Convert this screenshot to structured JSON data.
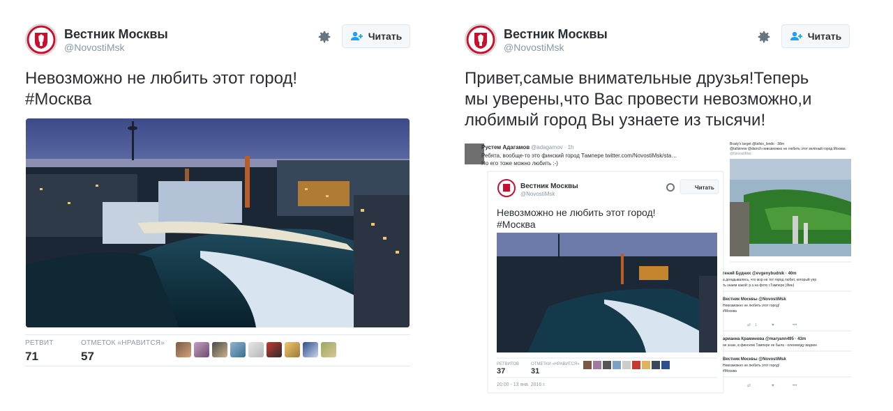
{
  "left_tweet": {
    "author_name": "Вестник Москвы",
    "author_handle": "@NovostiMsk",
    "follow_label": "Читать",
    "text_line1": "Невозможно не любить этот город!",
    "text_line2": "#Москва",
    "retweets_label": "РЕТВИТ",
    "retweets_value": "71",
    "likes_label": "ОТМЕТОК «НРАВИТСЯ»",
    "likes_value": "57"
  },
  "right_tweet": {
    "author_name": "Вестник Москвы",
    "author_handle": "@NovostiMsk",
    "follow_label": "Читать",
    "text_line1": "Привет,самые внимательные друзья!Теперь",
    "text_line2": "мы уверены,что Вас провести невозможно,и",
    "text_line3": "любимый город Вы узнаете из тысячи!"
  },
  "screenshot": {
    "reply_author": "Рустем Адагамов",
    "reply_handle": "@adagamov · 1h",
    "reply_line1": "Ребята, вообще-то это финский город Тампере twitter.com/NovostiMsk/sta…",
    "reply_line2": "Но его тоже можно любить :-)",
    "embed_author": "Вестник Москвы",
    "embed_handle": "@NovostiMsk",
    "embed_follow": "Читать",
    "embed_text1": "Невозможно не любить этот город!",
    "embed_text2": "#Москва",
    "embed_rt_label": "РЕТВИТОВ",
    "embed_rt_value": "37",
    "embed_like_label": "ОТМЕТКИ «НРАВИТСЯ»",
    "embed_like_value": "31",
    "embed_date": "20:00 - 13 янв. 2016 г.",
    "side_top1": "Brady's target @tafsis_londo · 38m",
    "side_top2": "@tafisinew @danich невозможно не любить этот зелёный город.Москва",
    "side_top3": "@NovostiMsk",
    "side_a_author": "гений Будних @evgenybudnik · 40m",
    "side_a_text1": "а догадывались, что мэр не тот город любит, который упр",
    "side_a_text2": "ть знаем какой: р.s.на фото г.Тампере (Фин)",
    "side_b_author": "Вестник Москвы @NovostiMsk",
    "side_b_text1": "Невозможно не любить этот город!",
    "side_b_text2": "#Москва",
    "side_c_author": "арианна Краминова @maryann495 · 43m",
    "side_c_text1": "не знаю, в финском Тампере не была - оленеводу виднее",
    "side_d_author": "Вестник Москвы @NovostiMsk",
    "side_d_text1": "Невозможно не любить этот город!",
    "side_d_text2": "#Москва",
    "side_count_rt": "1"
  },
  "colors": {
    "text": "#292f33",
    "muted": "#8899a6",
    "border": "#e1e8ed",
    "follow_icon": "#1da1f2",
    "emblem_red": "#c8102e"
  },
  "icons": [
    "moscow-emblem-icon",
    "gear-icon",
    "follow-person-icon",
    "retweet-icon",
    "heart-icon",
    "more-icon"
  ]
}
